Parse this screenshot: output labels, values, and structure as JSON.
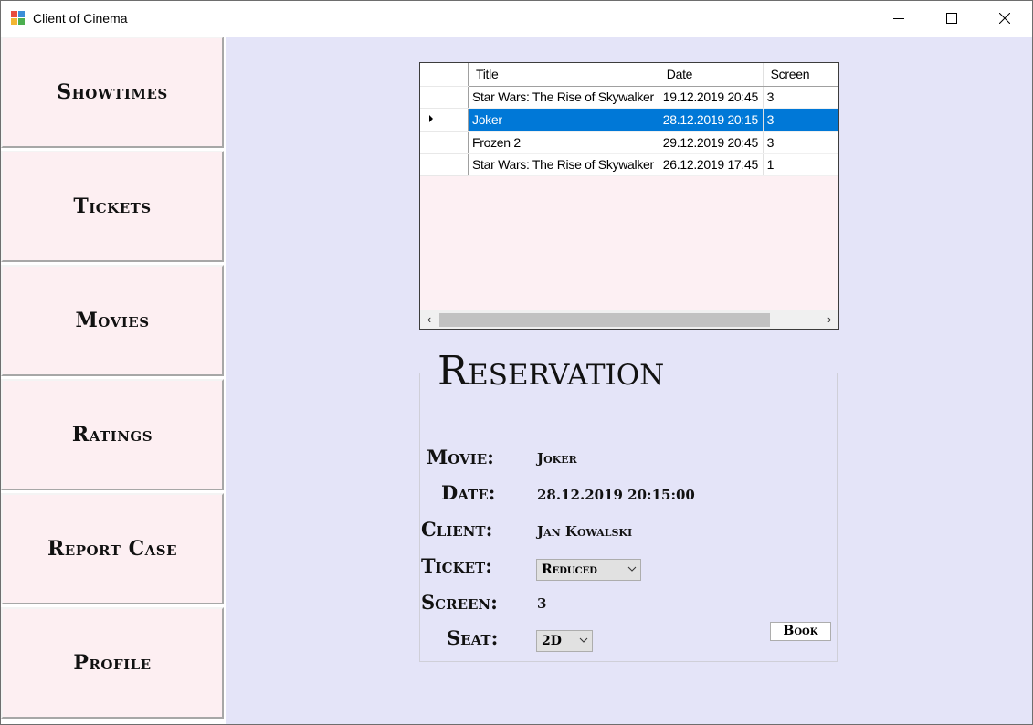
{
  "window": {
    "title": "Client of Cinema",
    "controls": [
      "minimize-icon",
      "maximize-icon",
      "close-icon"
    ]
  },
  "sidebar": {
    "items": [
      {
        "label": "Showtimes"
      },
      {
        "label": "Tickets"
      },
      {
        "label": "Movies"
      },
      {
        "label": "Ratings"
      },
      {
        "label": "Report Case"
      },
      {
        "label": "Profile"
      }
    ]
  },
  "grid": {
    "columns": [
      "Title",
      "Date",
      "Screen"
    ],
    "rows": [
      {
        "title": "Star Wars: The Rise of Skywalker",
        "date": "19.12.2019 20:45",
        "screen": "3",
        "selected": false
      },
      {
        "title": "Joker",
        "date": "28.12.2019 20:15",
        "screen": "3",
        "selected": true
      },
      {
        "title": "Frozen 2",
        "date": "29.12.2019 20:45",
        "screen": "3",
        "selected": false
      },
      {
        "title": "Star Wars: The Rise of Skywalker",
        "date": "26.12.2019 17:45",
        "screen": "1",
        "selected": false
      }
    ],
    "selected_row_marker": "current-row-arrow-icon"
  },
  "reservation": {
    "title": "Reservation",
    "movie_label": "Movie:",
    "movie_value": "Joker",
    "date_label": "Date:",
    "date_value": "28.12.2019 20:15:00",
    "client_label": "Client:",
    "client_value": "Jan Kowalski",
    "ticket_label": "Ticket:",
    "ticket_value": "Reduced",
    "screen_label": "Screen:",
    "screen_value": "3",
    "seat_label": "Seat:",
    "seat_value": "2D",
    "book_label": "Book"
  },
  "colors": {
    "client_bg": "#e4e4f8",
    "nav_button_bg": "#fdeff2",
    "selection": "#0078d7"
  }
}
